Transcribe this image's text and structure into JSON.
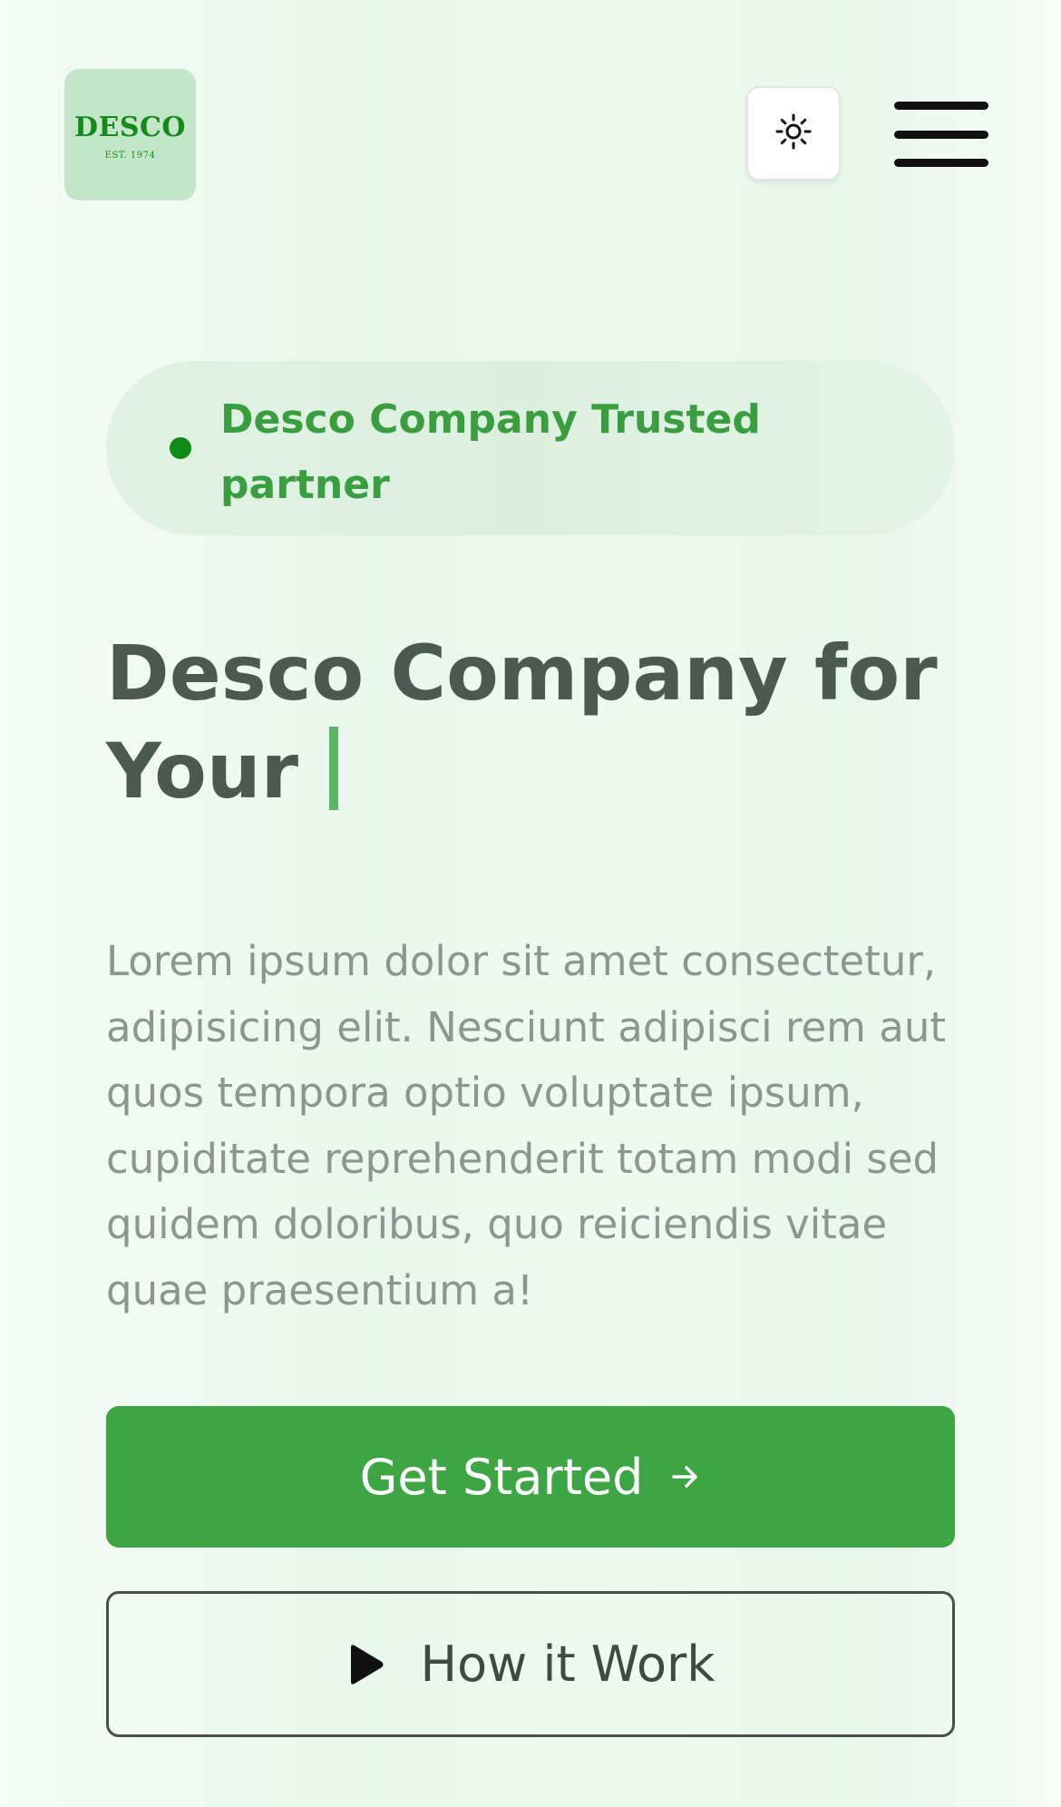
{
  "header": {
    "logo_text": "DESCO",
    "logo_subtext": "EST. 1974",
    "theme_toggle_icon": "sun-icon",
    "menu_icon": "hamburger-menu-icon"
  },
  "hero": {
    "badge_text": "Desco Company Trusted partner",
    "title": "Desco Company for Your",
    "description": "Lorem ipsum dolor sit amet consectetur, adipisicing elit. Nesciunt adipisci rem aut quos tempora optio voluptate ipsum, cupiditate reprehenderit totam modi sed quidem doloribus, quo reiciendis vitae quae praesentium a!",
    "primary_button": "Get Started",
    "primary_button_icon": "arrow-right-icon",
    "secondary_button": "How it Work",
    "secondary_button_icon": "play-icon"
  },
  "colors": {
    "brand_green": "#3da543",
    "logo_bg": "#c4e6c8",
    "dark_text": "#4a5a52",
    "muted_text": "#8d9590"
  }
}
